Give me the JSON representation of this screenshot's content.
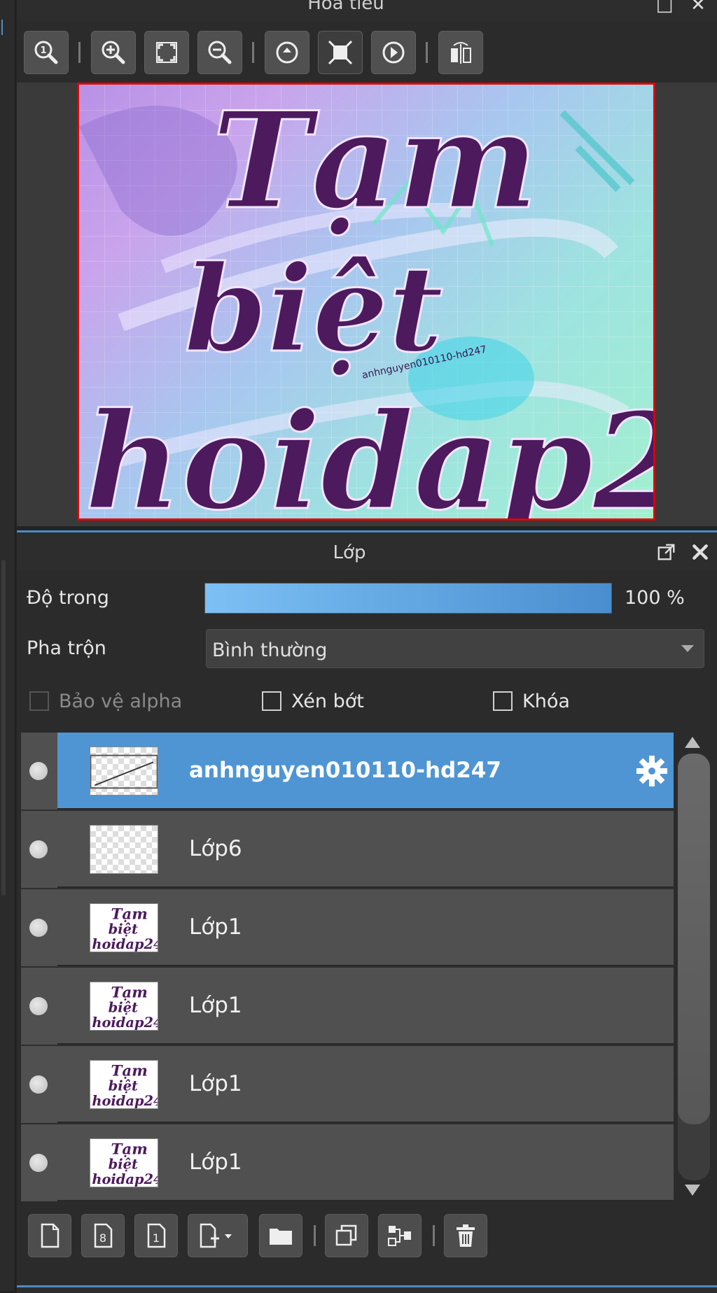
{
  "navigator": {
    "title": "Hoa tiêu",
    "toolbar": [
      "zoom-actual-icon",
      "zoom-in-icon",
      "fit-screen-icon",
      "zoom-out-icon",
      "rotate-left-icon",
      "fit-window-icon",
      "rotate-right-icon",
      "flip-horizontal-icon"
    ],
    "frame_color": "#e10000"
  },
  "layers": {
    "title": "Lớp",
    "opacity_label": "Độ trong",
    "opacity_value": "100 %",
    "opacity_fraction": 1.0,
    "blend_label": "Pha trộn",
    "blend_value": "Bình thường",
    "protect_alpha_label": "Bảo vệ alpha",
    "clip_label": "Xén bớt",
    "lock_label": "Khóa",
    "items": [
      {
        "name": "anhnguyen010110-hd247",
        "selected": true,
        "thumb": "text"
      },
      {
        "name": "Lớp6",
        "selected": false,
        "thumb": "empty"
      },
      {
        "name": "Lớp1",
        "selected": false,
        "thumb": "art"
      },
      {
        "name": "Lớp1",
        "selected": false,
        "thumb": "art"
      },
      {
        "name": "Lớp1",
        "selected": false,
        "thumb": "art"
      },
      {
        "name": "Lớp1",
        "selected": false,
        "thumb": "art"
      }
    ],
    "bottom_buttons": [
      "new-layer-icon",
      "new-8bit-layer-icon",
      "new-1bit-layer-icon",
      "add-layer-dropdown-icon",
      "new-folder-icon",
      "duplicate-layer-icon",
      "merge-down-icon",
      "delete-layer-icon"
    ]
  },
  "colors": {
    "accent": "#4a8cc8",
    "selected_row": "#4f95d3",
    "panel_bg": "#2b2b2b"
  }
}
